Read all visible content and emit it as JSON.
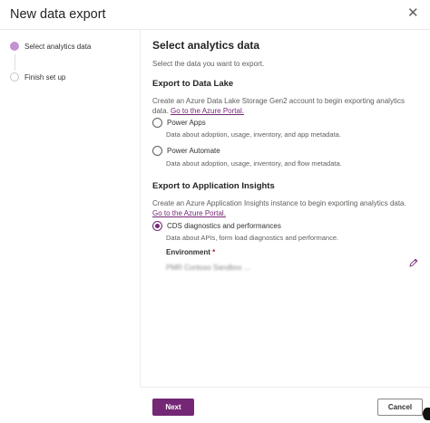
{
  "dialog": {
    "title": "New data export",
    "close_glyph": "✕"
  },
  "stepper": {
    "steps": [
      {
        "label": "Select analytics data",
        "state": "active"
      },
      {
        "label": "Finish set up",
        "state": "inactive"
      }
    ]
  },
  "main": {
    "title": "Select analytics data",
    "subtitle": "Select the data you want to export.",
    "data_lake": {
      "heading": "Export to Data Lake",
      "description": "Create an Azure Data Lake Storage Gen2 account to begin exporting analytics data. ",
      "link": "Go to the Azure Portal.",
      "options": [
        {
          "label": "Power Apps",
          "description": "Data about adoption, usage, inventory, and app metadata.",
          "checked": false
        },
        {
          "label": "Power Automate",
          "description": "Data about adoption, usage, inventory, and flow metadata.",
          "checked": false
        }
      ]
    },
    "app_insights": {
      "heading": "Export to Application Insights",
      "description": "Create an Azure Application Insights instance to begin exporting analytics data. ",
      "link": "Go to the Azure Portal.",
      "options": [
        {
          "label": "CDS diagnostics and performances",
          "description": "Data about APIs, form load diagnostics and performance.",
          "checked": true
        }
      ],
      "environment": {
        "label": "Environment",
        "required_mark": "*",
        "value": "PMR Contoso Sandbox ..."
      }
    }
  },
  "footer": {
    "next_label": "Next",
    "cancel_label": "Cancel"
  },
  "colors": {
    "accent": "#742774",
    "step_active": "#c293d4",
    "required": "#a4262c"
  },
  "icons": {
    "close": "close-icon",
    "edit": "pencil-icon"
  }
}
